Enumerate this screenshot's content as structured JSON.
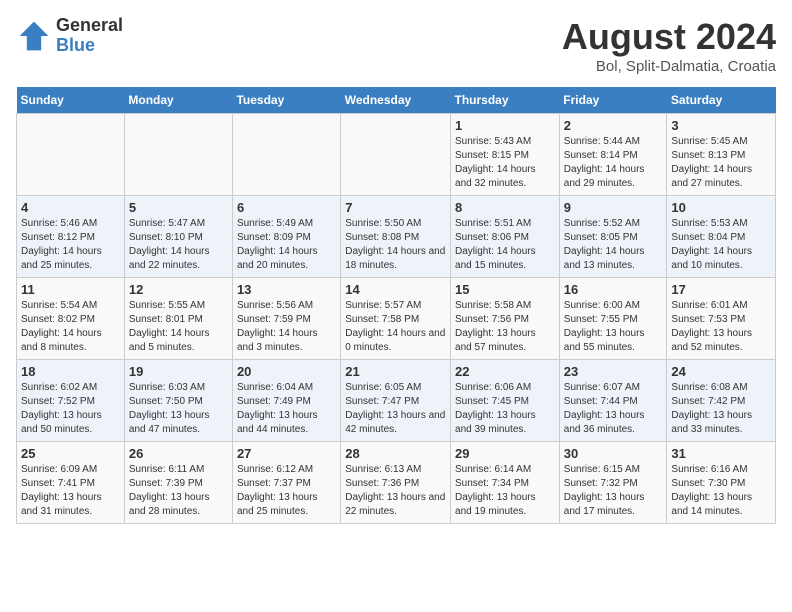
{
  "header": {
    "logo_general": "General",
    "logo_blue": "Blue",
    "title": "August 2024",
    "subtitle": "Bol, Split-Dalmatia, Croatia"
  },
  "days_of_week": [
    "Sunday",
    "Monday",
    "Tuesday",
    "Wednesday",
    "Thursday",
    "Friday",
    "Saturday"
  ],
  "weeks": [
    [
      {
        "day": "",
        "detail": ""
      },
      {
        "day": "",
        "detail": ""
      },
      {
        "day": "",
        "detail": ""
      },
      {
        "day": "",
        "detail": ""
      },
      {
        "day": "1",
        "detail": "Sunrise: 5:43 AM\nSunset: 8:15 PM\nDaylight: 14 hours\nand 32 minutes."
      },
      {
        "day": "2",
        "detail": "Sunrise: 5:44 AM\nSunset: 8:14 PM\nDaylight: 14 hours\nand 29 minutes."
      },
      {
        "day": "3",
        "detail": "Sunrise: 5:45 AM\nSunset: 8:13 PM\nDaylight: 14 hours\nand 27 minutes."
      }
    ],
    [
      {
        "day": "4",
        "detail": "Sunrise: 5:46 AM\nSunset: 8:12 PM\nDaylight: 14 hours\nand 25 minutes."
      },
      {
        "day": "5",
        "detail": "Sunrise: 5:47 AM\nSunset: 8:10 PM\nDaylight: 14 hours\nand 22 minutes."
      },
      {
        "day": "6",
        "detail": "Sunrise: 5:49 AM\nSunset: 8:09 PM\nDaylight: 14 hours\nand 20 minutes."
      },
      {
        "day": "7",
        "detail": "Sunrise: 5:50 AM\nSunset: 8:08 PM\nDaylight: 14 hours\nand 18 minutes."
      },
      {
        "day": "8",
        "detail": "Sunrise: 5:51 AM\nSunset: 8:06 PM\nDaylight: 14 hours\nand 15 minutes."
      },
      {
        "day": "9",
        "detail": "Sunrise: 5:52 AM\nSunset: 8:05 PM\nDaylight: 14 hours\nand 13 minutes."
      },
      {
        "day": "10",
        "detail": "Sunrise: 5:53 AM\nSunset: 8:04 PM\nDaylight: 14 hours\nand 10 minutes."
      }
    ],
    [
      {
        "day": "11",
        "detail": "Sunrise: 5:54 AM\nSunset: 8:02 PM\nDaylight: 14 hours\nand 8 minutes."
      },
      {
        "day": "12",
        "detail": "Sunrise: 5:55 AM\nSunset: 8:01 PM\nDaylight: 14 hours\nand 5 minutes."
      },
      {
        "day": "13",
        "detail": "Sunrise: 5:56 AM\nSunset: 7:59 PM\nDaylight: 14 hours\nand 3 minutes."
      },
      {
        "day": "14",
        "detail": "Sunrise: 5:57 AM\nSunset: 7:58 PM\nDaylight: 14 hours\nand 0 minutes."
      },
      {
        "day": "15",
        "detail": "Sunrise: 5:58 AM\nSunset: 7:56 PM\nDaylight: 13 hours\nand 57 minutes."
      },
      {
        "day": "16",
        "detail": "Sunrise: 6:00 AM\nSunset: 7:55 PM\nDaylight: 13 hours\nand 55 minutes."
      },
      {
        "day": "17",
        "detail": "Sunrise: 6:01 AM\nSunset: 7:53 PM\nDaylight: 13 hours\nand 52 minutes."
      }
    ],
    [
      {
        "day": "18",
        "detail": "Sunrise: 6:02 AM\nSunset: 7:52 PM\nDaylight: 13 hours\nand 50 minutes."
      },
      {
        "day": "19",
        "detail": "Sunrise: 6:03 AM\nSunset: 7:50 PM\nDaylight: 13 hours\nand 47 minutes."
      },
      {
        "day": "20",
        "detail": "Sunrise: 6:04 AM\nSunset: 7:49 PM\nDaylight: 13 hours\nand 44 minutes."
      },
      {
        "day": "21",
        "detail": "Sunrise: 6:05 AM\nSunset: 7:47 PM\nDaylight: 13 hours\nand 42 minutes."
      },
      {
        "day": "22",
        "detail": "Sunrise: 6:06 AM\nSunset: 7:45 PM\nDaylight: 13 hours\nand 39 minutes."
      },
      {
        "day": "23",
        "detail": "Sunrise: 6:07 AM\nSunset: 7:44 PM\nDaylight: 13 hours\nand 36 minutes."
      },
      {
        "day": "24",
        "detail": "Sunrise: 6:08 AM\nSunset: 7:42 PM\nDaylight: 13 hours\nand 33 minutes."
      }
    ],
    [
      {
        "day": "25",
        "detail": "Sunrise: 6:09 AM\nSunset: 7:41 PM\nDaylight: 13 hours\nand 31 minutes."
      },
      {
        "day": "26",
        "detail": "Sunrise: 6:11 AM\nSunset: 7:39 PM\nDaylight: 13 hours\nand 28 minutes."
      },
      {
        "day": "27",
        "detail": "Sunrise: 6:12 AM\nSunset: 7:37 PM\nDaylight: 13 hours\nand 25 minutes."
      },
      {
        "day": "28",
        "detail": "Sunrise: 6:13 AM\nSunset: 7:36 PM\nDaylight: 13 hours\nand 22 minutes."
      },
      {
        "day": "29",
        "detail": "Sunrise: 6:14 AM\nSunset: 7:34 PM\nDaylight: 13 hours\nand 19 minutes."
      },
      {
        "day": "30",
        "detail": "Sunrise: 6:15 AM\nSunset: 7:32 PM\nDaylight: 13 hours\nand 17 minutes."
      },
      {
        "day": "31",
        "detail": "Sunrise: 6:16 AM\nSunset: 7:30 PM\nDaylight: 13 hours\nand 14 minutes."
      }
    ]
  ]
}
